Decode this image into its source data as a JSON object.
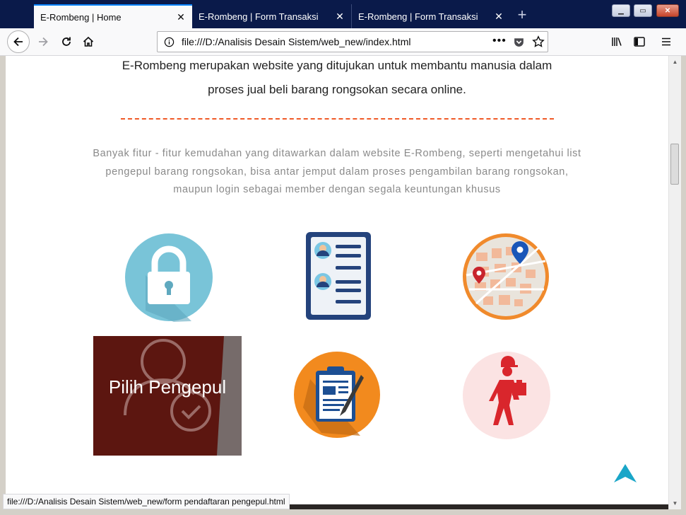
{
  "browser": {
    "tabs": [
      {
        "title": "E-Rombeng | Home",
        "active": true
      },
      {
        "title": "E-Rombeng | Form Transaksi",
        "active": false
      },
      {
        "title": "E-Rombeng | Form Transaksi",
        "active": false
      }
    ],
    "url": "file:///D:/Analisis Desain Sistem/web_new/index.html",
    "status_url": "file:///D:/Analisis Desain Sistem/web_new/form pendaftaran pengepul.html"
  },
  "page": {
    "intro_line1": "E-Rombeng merupakan website yang ditujukan untuk membantu manusia dalam",
    "intro_line2": "proses jual beli barang rongsokan secara online.",
    "features_line1": "Banyak fitur - fitur kemudahan yang ditawarkan dalam website E-Rombeng, seperti mengetahui list",
    "features_line2": "pengepul barang rongsokan, bisa antar jemput dalam proses pengambilan barang rongsokan,",
    "features_line3": "maupun login sebagai member dengan segala keuntungan khusus",
    "hover_card_title": "Pilih Pengepul",
    "colors": {
      "accent_dashed": "#f05a28",
      "hover_card_bg": "#5c1610",
      "back_to_top": "#1aa6c8"
    },
    "feature_icons": [
      "lock-icon",
      "member-list-icon",
      "map-location-icon",
      "choose-collector-icon",
      "form-clipboard-icon",
      "delivery-courier-icon"
    ]
  }
}
